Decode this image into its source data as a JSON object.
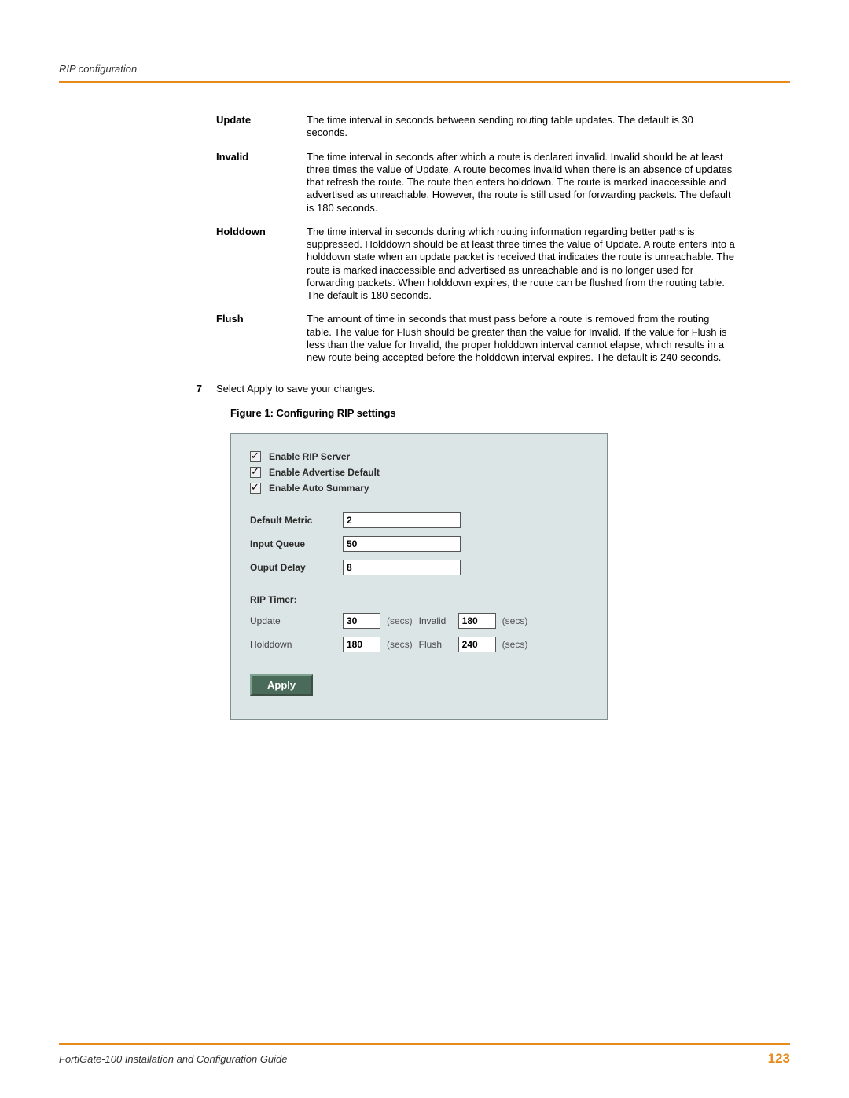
{
  "header": {
    "section": "RIP configuration"
  },
  "definitions": [
    {
      "term": "Update",
      "desc": "The time interval in seconds between sending routing table updates. The default is 30 seconds."
    },
    {
      "term": "Invalid",
      "desc": "The time interval in seconds after which a route is declared invalid. Invalid should be at least three times the value of Update. A route becomes invalid when there is an absence of updates that refresh the route. The route then enters holddown. The route is marked inaccessible and advertised as unreachable. However, the route is still used for forwarding packets. The default is 180 seconds."
    },
    {
      "term": "Holddown",
      "desc": "The time interval in seconds during which routing information regarding better paths is suppressed. Holddown should be at least three times the value of Update. A route enters into a holddown state when an update packet is received that indicates the route is unreachable. The route is marked inaccessible and advertised as unreachable and is no longer used for forwarding packets. When holddown expires, the route can be flushed from the routing table. The default is 180 seconds."
    },
    {
      "term": "Flush",
      "desc": "The amount of time in seconds that must pass before a route is removed from the routing table. The value for Flush should be greater than the value for Invalid. If the value for Flush is less than the value for Invalid, the proper holddown interval cannot elapse, which results in a new route being accepted before the holddown interval expires. The default is 240 seconds."
    }
  ],
  "step": {
    "num": "7",
    "text": "Select Apply to save your changes."
  },
  "figure_caption": "Figure 1:  Configuring RIP settings",
  "figure": {
    "checkboxes": [
      {
        "label": "Enable RIP Server"
      },
      {
        "label": "Enable Advertise Default"
      },
      {
        "label": "Enable Auto Summary"
      }
    ],
    "fields": {
      "default_metric": {
        "label": "Default Metric",
        "value": "2"
      },
      "input_queue": {
        "label": "Input Queue",
        "value": "50"
      },
      "output_delay": {
        "label": "Ouput Delay",
        "value": "8"
      }
    },
    "timer_title": "RIP Timer:",
    "timers": {
      "update": {
        "label": "Update",
        "value": "30",
        "unit": "(secs)"
      },
      "invalid": {
        "label": "Invalid",
        "value": "180",
        "unit": "(secs)"
      },
      "holddown": {
        "label": "Holddown",
        "value": "180",
        "unit": "(secs)"
      },
      "flush": {
        "label": "Flush",
        "value": "240",
        "unit": "(secs)"
      }
    },
    "apply": "Apply"
  },
  "footer": {
    "guide": "FortiGate-100 Installation and Configuration Guide",
    "page": "123"
  }
}
